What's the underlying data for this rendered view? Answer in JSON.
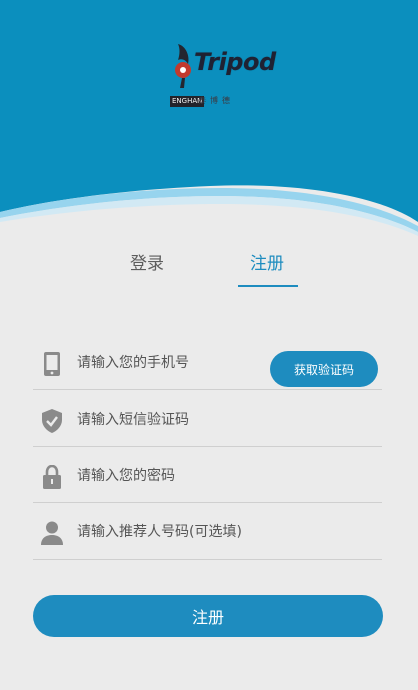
{
  "colors": {
    "accent": "#1e8cbf",
    "header_bg": "#0b8fbe",
    "page_bg": "#ebebeb",
    "icon_gray": "#8a8a8a"
  },
  "logo": {
    "word": "Tripod",
    "badge": "ENGHAN",
    "sub": "泰博德"
  },
  "tabs": [
    {
      "label": "登录",
      "active": false
    },
    {
      "label": "注册",
      "active": true
    }
  ],
  "form": {
    "phone": {
      "icon": "phone-icon",
      "placeholder": "请输入您的手机号",
      "value": ""
    },
    "get_code_label": "获取验证码",
    "sms_code": {
      "icon": "shield-check-icon",
      "placeholder": "请输入短信验证码",
      "value": ""
    },
    "password": {
      "icon": "lock-icon",
      "placeholder": "请输入您的密码",
      "value": ""
    },
    "referral": {
      "icon": "person-icon",
      "placeholder": "请输入推荐人号码(可选填)",
      "value": ""
    },
    "submit_label": "注册"
  }
}
